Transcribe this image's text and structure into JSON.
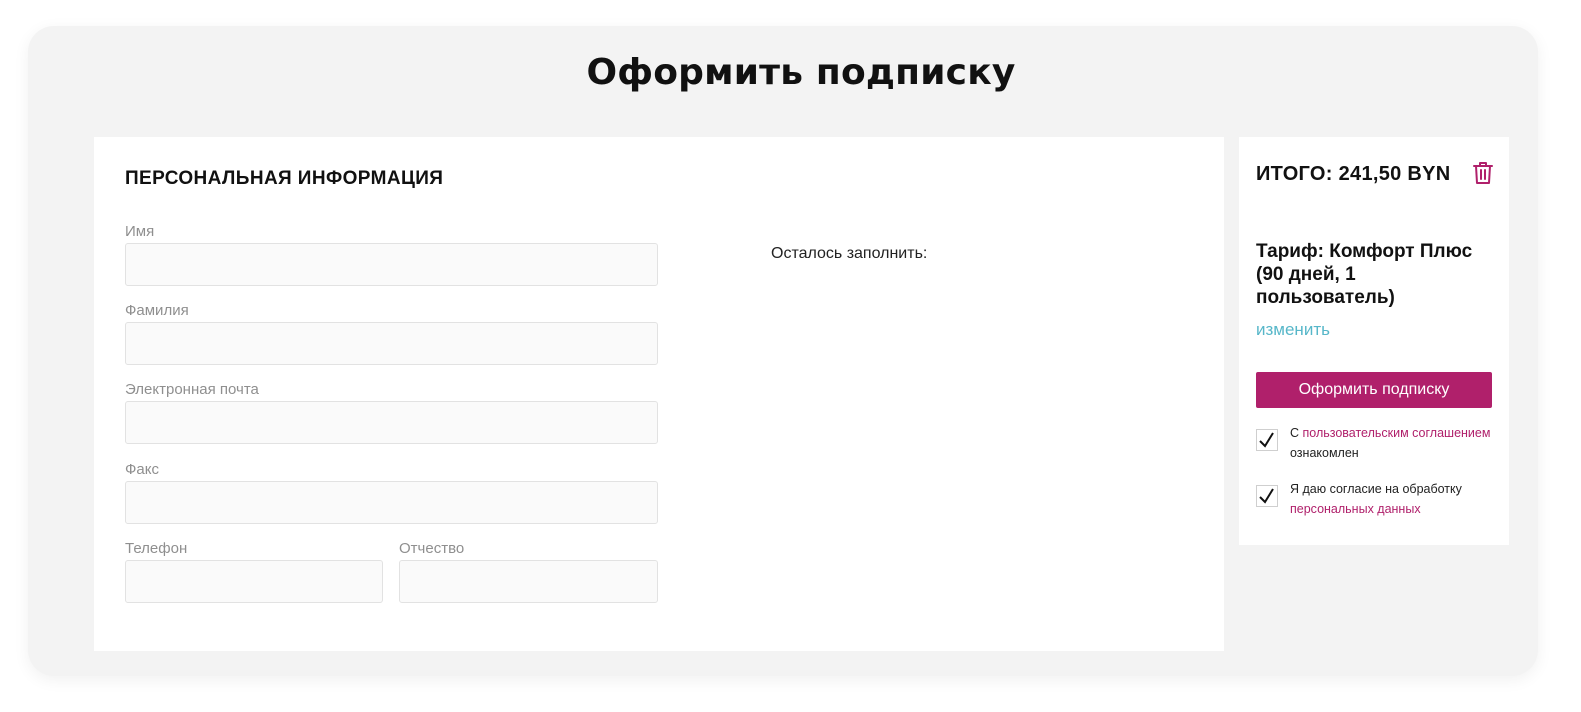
{
  "page": {
    "title": "Оформить подписку"
  },
  "form": {
    "section_title": "ПЕРСОНАЛЬНАЯ ИНФОРМАЦИЯ",
    "fields": {
      "first_name": {
        "label": "Имя",
        "value": ""
      },
      "last_name": {
        "label": "Фамилия",
        "value": ""
      },
      "email": {
        "label": "Электронная почта",
        "value": ""
      },
      "fax": {
        "label": "Факс",
        "value": ""
      },
      "phone": {
        "label": "Телефон",
        "value": ""
      },
      "middle_name": {
        "label": "Отчество",
        "value": ""
      }
    },
    "remaining_label": "Осталось заполнить:"
  },
  "summary": {
    "total": "ИТОГО: 241,50 BYN",
    "delete_icon": "trash-icon",
    "tariff": "Тариф: Комфорт Плюс (90 дней, 1 пользователь)",
    "change_link": "изменить",
    "submit_label": "Оформить подписку",
    "agreements": [
      {
        "checked": true,
        "prefix": "С ",
        "link": "пользовательским соглашением",
        "suffix": " ознакомлен"
      },
      {
        "checked": true,
        "prefix": "Я даю согласие на обработку ",
        "link": "персональных данных",
        "suffix": ""
      }
    ]
  },
  "colors": {
    "accent": "#b0206b",
    "link": "#57b7c9",
    "background": "#f3f3f3"
  }
}
